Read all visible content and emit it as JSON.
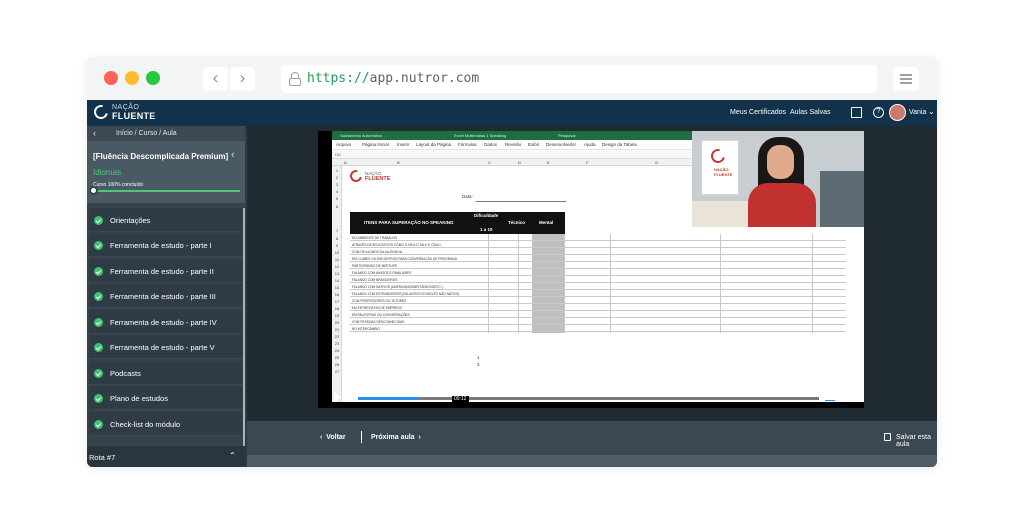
{
  "browser": {
    "url_scheme": "https://",
    "url_host": "app.nutror.com"
  },
  "topbar": {
    "logo_line1": "NAÇÃO",
    "logo_line2": "FLUENTE",
    "certificates": "Meus Certificados",
    "saved_lessons": "Aulas Salvas",
    "user_name": "Vania"
  },
  "sidebar": {
    "breadcrumb": "Início / Curso / Aula",
    "course_title": "[Fluência Descomplicada Premium]",
    "category": "Idiomas",
    "progress_text": "Curso 100% concluído",
    "progress_value": 1.0,
    "items": [
      {
        "label": "Orientações"
      },
      {
        "label": "Ferramenta de estudo - parte I"
      },
      {
        "label": "Ferramenta de estudo - parte II"
      },
      {
        "label": "Ferramenta de estudo - parte III"
      },
      {
        "label": "Ferramenta de estudo - parte IV"
      },
      {
        "label": "Ferramenta de estudo - parte V"
      },
      {
        "label": "Podcasts"
      },
      {
        "label": "Plano de estudos"
      },
      {
        "label": "Check-list do módulo"
      }
    ],
    "footer_label": "Rota #7"
  },
  "spreadsheet": {
    "title_autosave": "Salvamento Automático",
    "title_file": "Excel Multimídias 1 Speaking",
    "title_search": "Pesquisar",
    "tabs": [
      "Arquivo",
      "Página Inicial",
      "Inserir",
      "Layout da Página",
      "Fórmulas",
      "Dados",
      "Revisão",
      "Exibir",
      "Desenvolvedor",
      "Ajuda",
      "Design da Tabela"
    ],
    "cell_ref": "I10",
    "columns": [
      "A",
      "B",
      "C",
      "D",
      "E",
      "F",
      "G"
    ],
    "rows": [
      "1",
      "2",
      "3",
      "4",
      "5",
      "6",
      "7",
      "8",
      "9",
      "10",
      "11",
      "12",
      "13",
      "14",
      "15",
      "16",
      "17",
      "18",
      "19",
      "20",
      "21",
      "22",
      "23",
      "24",
      "25",
      "26",
      "27"
    ],
    "logo_line1": "NAÇÃO",
    "logo_line2": "FLUENTE",
    "data_label": "Data:",
    "header_items": "ITENS PARA SUPERAÇÃO NO SPEAKING",
    "header_difficulty": "Dificuldade",
    "header_scale": "1 a 10",
    "header_technical": "Técnico",
    "header_mental": "Mental",
    "list": [
      "NO AMBIENTE DE TRABALHO",
      "ATRAVÉS DE APLICATIVOS COMO O HELLO TALK E ITALKI",
      "COM OS ALUNOS DA ALLENGLIA",
      "EM CLUBES OU ENCONTROS PARA CONVERSAÇÃO DE PROGRAMA",
      "PARTICIPANDO DE MEETUPS",
      "FALANDO COM AMIGOS E FAMILIARES",
      "FALANDO COM BRASILEIROS",
      "FALANDO COM NATIVOS (AMERICANOS/BRITÂNICOS/ETC.)",
      "FALANDO COM ESTRANGEIROS (FALANTES DO INGLÊS NÃO NATIVO)",
      "COM PROFESSORES OU TUTORES",
      "EM ENTREVISTAS DE EMPREGO",
      "EM PALESTRAS OU CONVERSAÇÕES",
      "COM PESSOAS DESCONHECIDAS",
      "NO INTERCÂMBIO"
    ],
    "bottom_1": "1",
    "bottom_2": "3"
  },
  "cam": {
    "poster_text": "NAÇÃO FLUENTE"
  },
  "player": {
    "time": "00:12",
    "progress": 0.13
  },
  "bottom": {
    "back": "Voltar",
    "next": "Próxima aula",
    "save": "Salvar esta aula"
  }
}
